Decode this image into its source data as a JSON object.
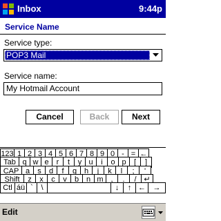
{
  "titlebar": {
    "title": "Inbox",
    "time": "9:44p"
  },
  "page": {
    "title": "Service Name"
  },
  "form": {
    "service_type_label": "Service type:",
    "service_type_value": "POP3 Mail",
    "service_name_label": "Service name:",
    "service_name_value": "My Hotmail Account"
  },
  "buttons": {
    "cancel": "Cancel",
    "back": "Back",
    "next": "Next"
  },
  "keyboard": {
    "row1": [
      "123",
      "1",
      "2",
      "3",
      "4",
      "5",
      "6",
      "7",
      "8",
      "9",
      "0",
      "-",
      "=",
      "←"
    ],
    "row2": [
      "Tab",
      "q",
      "w",
      "e",
      "r",
      "t",
      "y",
      "u",
      "i",
      "o",
      "p",
      "[",
      "]"
    ],
    "row3": [
      "CAP",
      "a",
      "s",
      "d",
      "f",
      "g",
      "h",
      "j",
      "k",
      "l",
      ";",
      "'"
    ],
    "row4": [
      "Shift",
      "z",
      "x",
      "c",
      "v",
      "b",
      "n",
      "m",
      ",",
      ".",
      "/",
      "↵"
    ],
    "row5": [
      "Ctl",
      "áü",
      "`",
      "\\",
      "↓",
      "↑",
      "←",
      "→"
    ]
  },
  "menubar": {
    "edit": "Edit",
    "sip_icon": "keyboard-icon"
  },
  "colors": {
    "titlebar": "#0000a0",
    "selection": "#0000a0",
    "header_text": "#0000a0"
  }
}
